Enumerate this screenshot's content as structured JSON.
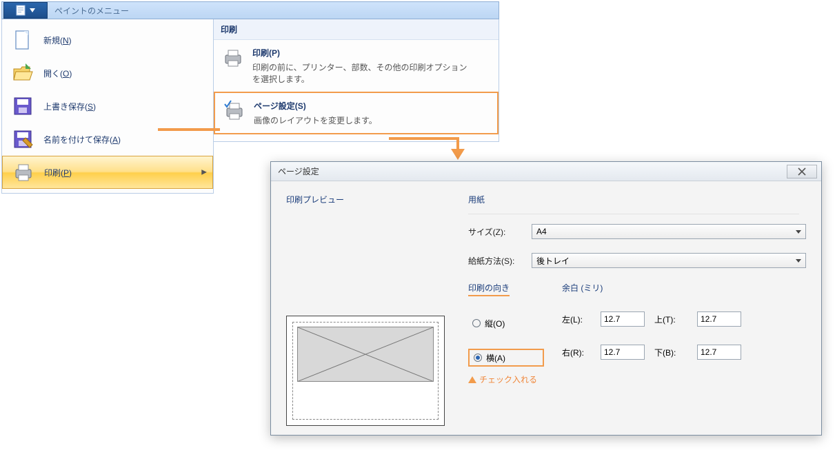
{
  "ribbon": {
    "title": "ペイントのメニュー"
  },
  "appmenu": {
    "items": [
      {
        "label_pre": "新規(",
        "mnemonic": "N",
        "label_post": ")"
      },
      {
        "label_pre": "開く(",
        "mnemonic": "O",
        "label_post": ")"
      },
      {
        "label_pre": "上書き保存(",
        "mnemonic": "S",
        "label_post": ")"
      },
      {
        "label_pre": "名前を付けて保存(",
        "mnemonic": "A",
        "label_post": ")"
      },
      {
        "label_pre": "印刷(",
        "mnemonic": "P",
        "label_post": ")"
      }
    ]
  },
  "submenu": {
    "header": "印刷",
    "items": [
      {
        "title_pre": "印刷(",
        "title_mnemonic": "P",
        "title_post": ")",
        "desc": "印刷の前に、プリンター、部数、その他の印刷オプションを選択します。"
      },
      {
        "title_pre": "ページ設定(",
        "title_mnemonic": "S",
        "title_post": ")",
        "desc": "画像のレイアウトを変更します。"
      }
    ]
  },
  "dialog": {
    "title": "ページ設定",
    "preview_heading": "印刷プレビュー",
    "paper_heading": "用紙",
    "size_label": "サイズ(Z):",
    "size_value": "A4",
    "source_label": "給紙方法(S):",
    "source_value": "後トレイ",
    "orient_heading": "印刷の向き",
    "orient_portrait_label": "縦(O)",
    "orient_landscape_label": "横(A)",
    "orient_selected": "landscape",
    "margins_heading": "余白 (ミリ)",
    "margins_left_label": "左(L):",
    "margins_right_label": "右(R):",
    "margins_top_label": "上(T):",
    "margins_bottom_label": "下(B):",
    "margins_left_value": "12.7",
    "margins_right_value": "12.7",
    "margins_top_value": "12.7",
    "margins_bottom_value": "12.7",
    "annotation_text": "チェック入れる"
  }
}
